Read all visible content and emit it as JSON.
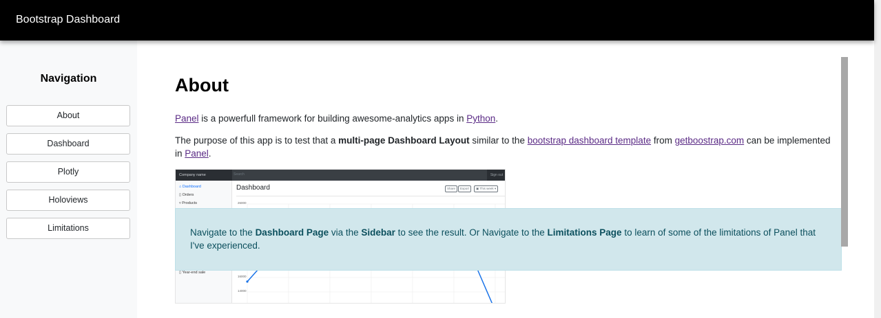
{
  "header": {
    "brand": "Bootstrap Dashboard"
  },
  "sidebar": {
    "title": "Navigation",
    "items": [
      {
        "label": "About"
      },
      {
        "label": "Dashboard"
      },
      {
        "label": "Plotly"
      },
      {
        "label": "Holoviews"
      },
      {
        "label": "Limitations"
      }
    ]
  },
  "main": {
    "title": "About",
    "intro": {
      "link1": "Panel",
      "text1": " is a powerfull framework for building awesome-analytics apps in ",
      "link2": "Python",
      "text2": "."
    },
    "purpose": {
      "text1": "The purpose of this app is to test that a ",
      "bold1": "multi-page Dashboard Layout",
      "text2": " similar to the ",
      "link1": "bootstrap dashboard template",
      "text3": " from ",
      "link2": "getboostrap.com",
      "text4": " can be implemented in ",
      "link3": "Panel",
      "text5": "."
    },
    "preview": {
      "company": "Company name",
      "search": "Search",
      "signout": "Sign out",
      "nav": [
        "Dashboard",
        "Orders",
        "Products",
        "Year-end sale"
      ],
      "heading": "Dashboard",
      "buttons": [
        "Share",
        "Export",
        "This week"
      ],
      "yticks": [
        "26000",
        "16000",
        "14000"
      ]
    },
    "alert": {
      "t1": "Navigate to the ",
      "b1": "Dashboard Page",
      "t2": " via the ",
      "b2": "Sidebar",
      "t3": " to see the result. Or Navigate to the ",
      "b3": "Limitations Page",
      "t4": " to learn of some of the limitations of Panel that I've experienced."
    }
  },
  "colors": {
    "topbar": "#000000",
    "sidebar_bg": "#f8f9fa",
    "link": "#5a2a85",
    "alert_bg": "#d1e7ec",
    "alert_text": "#0b4f5d"
  }
}
